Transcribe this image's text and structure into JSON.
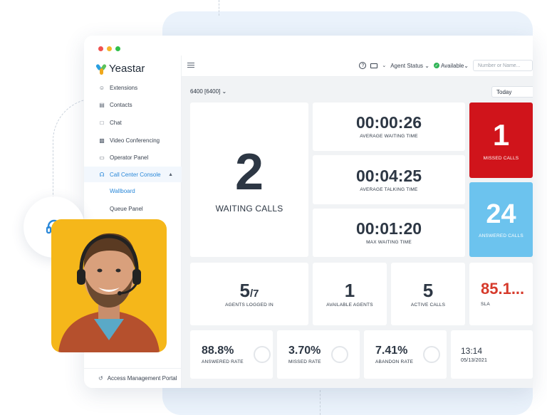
{
  "colors": {
    "accent": "#2a88d9",
    "missed_bg": "#d0141b",
    "answered_bg": "#6cc3ee",
    "sla_value": "#d63a2b",
    "photo_bg": "#f5b71a",
    "available_green": "#31b457"
  },
  "sidebar": {
    "logo_text": "Yeastar",
    "items": [
      {
        "label": "Extensions",
        "icon": "user-icon"
      },
      {
        "label": "Contacts",
        "icon": "contacts-icon"
      },
      {
        "label": "Chat",
        "icon": "chat-icon"
      },
      {
        "label": "Video Conferencing",
        "icon": "video-icon"
      },
      {
        "label": "Operator Panel",
        "icon": "monitor-icon"
      },
      {
        "label": "Call Center Console",
        "icon": "headset-icon"
      }
    ],
    "sub_items": [
      {
        "label": "Wallboard"
      },
      {
        "label": "Queue Panel"
      }
    ],
    "footer": "Access Management Portal"
  },
  "topbar": {
    "agent_status": "Agent Status",
    "available": "Available",
    "search_placeholder": "Number or Name..."
  },
  "content": {
    "queue": "6400 [6400]",
    "period": "Today"
  },
  "wallboard": {
    "waiting_calls": {
      "value": "2",
      "label": "WAITING CALLS"
    },
    "avg_waiting": {
      "value": "00:00:26",
      "label": "AVERAGE WAITING TIME"
    },
    "avg_talking": {
      "value": "00:04:25",
      "label": "AVERAGE TALKING TIME"
    },
    "max_waiting": {
      "value": "00:01:20",
      "label": "MAX WAITING TIME"
    },
    "missed_calls": {
      "value": "1",
      "label": "MISSED CALLS"
    },
    "answered_calls": {
      "value": "24",
      "label": "ANSWERED CALLS"
    },
    "agents_logged_in": {
      "value": "5",
      "total": "/7",
      "label": "AGENTS LOGGED IN"
    },
    "available_agents": {
      "value": "1",
      "label": "AVAILABLE AGENTS"
    },
    "active_calls": {
      "value": "5",
      "label": "ACTIVE CALLS"
    },
    "sla": {
      "value": "85.1...",
      "label": "SLA"
    },
    "answered_rate": {
      "value": "88.8%",
      "label": "ANSWERED RATE"
    },
    "missed_rate": {
      "value": "3.70%",
      "label": "MISSED RATE"
    },
    "abandon_rate": {
      "value": "7.41%",
      "label": "ABANDON RATE"
    },
    "clock": {
      "time": "13:14",
      "date": "05/13/2021"
    }
  }
}
